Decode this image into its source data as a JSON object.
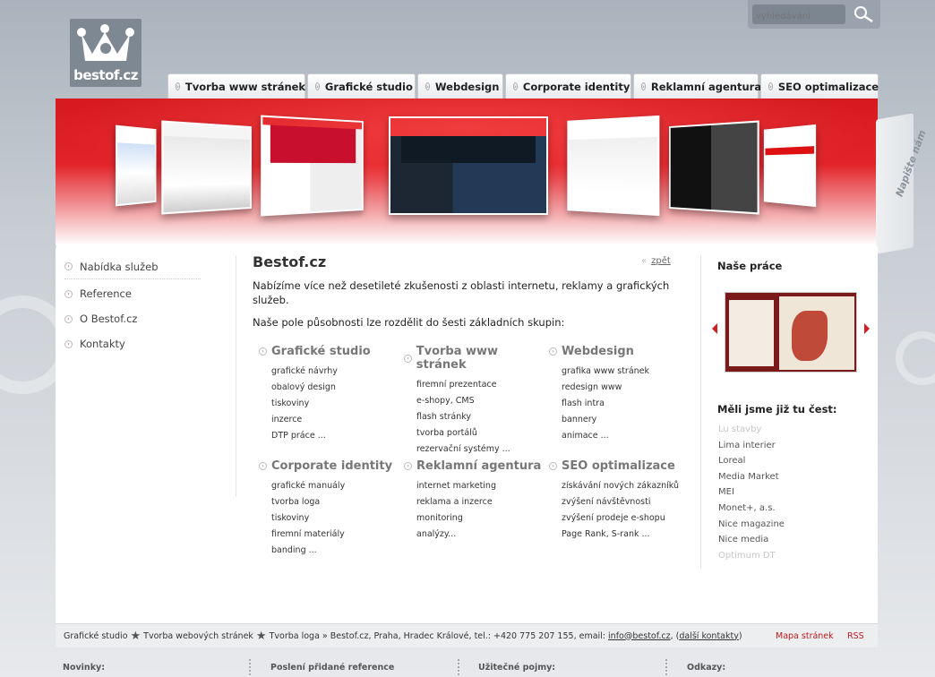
{
  "logo": {
    "text": "bestof.cz"
  },
  "search": {
    "placeholder": "vyhledávání"
  },
  "tabs": [
    "Tvorba www stránek",
    "Grafické studio",
    "Webdesign",
    "Corporate identity",
    "Reklamní agentura",
    "SEO optimalizace"
  ],
  "napiste": "Napište nám",
  "nav": [
    "Nabídka služeb",
    "Reference",
    "O Bestof.cz",
    "Kontakty"
  ],
  "content": {
    "title": "Bestof.cz",
    "back": "zpět",
    "intro": "Nabízíme více než desetileté zkušenosti z oblasti internetu, reklamy a grafických služeb.",
    "intro2": "Naše pole působnosti lze rozdělit do šesti základních skupin:",
    "groups": [
      {
        "title": "Grafické studio",
        "items": [
          "grafické návrhy",
          "obalový design",
          "tiskoviny",
          "inzerce",
          "DTP práce ..."
        ]
      },
      {
        "title": "Tvorba www stránek",
        "items": [
          "firemní prezentace",
          "e-shopy, CMS",
          "flash stránky",
          "tvorba portálů",
          "rezervační systémy ..."
        ]
      },
      {
        "title": "Webdesign",
        "items": [
          "grafika www stránek",
          "redesign www",
          "flash intra",
          "bannery",
          "animace ..."
        ]
      },
      {
        "title": "Corporate identity",
        "items": [
          "grafické manuály",
          "tvorba loga",
          "tiskoviny",
          "firemní materiály",
          "banding ..."
        ]
      },
      {
        "title": "Reklamní agentura",
        "items": [
          "internet marketing",
          "reklama a inzerce",
          "monitoring",
          "analýzy..."
        ]
      },
      {
        "title": "SEO optimalizace",
        "items": [
          "získávání nových zákazníků",
          "zvýšení návštěvnosti",
          "zvýšení prodeje e-shopu",
          "Page Rank, S-rank ..."
        ]
      }
    ]
  },
  "right": {
    "work_title": "Naše práce",
    "honor_title": "Měli jsme již tu čest:",
    "clients": [
      "Lu stavby",
      "Lima interier",
      "Loreal",
      "Media Market",
      "MEI",
      "Monet+, a.s.",
      "Nice magazine",
      "Nice media",
      "Optimum DT"
    ]
  },
  "footer": {
    "link1": "Grafické studio",
    "link2": "Tvorba webových stránek",
    "link3": "Tvorba loga",
    "info": "Bestof.cz, Praha, Hradec Králové, tel.: +420 775 207 155, email:",
    "email": "info@bestof.cz",
    "more_contacts": "další kontakty",
    "sitemap": "Mapa stránek",
    "rss": "RSS"
  },
  "bottom": [
    "Novinky:",
    "Poslení přidané reference",
    "Užitečné pojmy:",
    "Odkazy:"
  ],
  "colors": {
    "brand_red": "#d51a1f",
    "gray_bg": "#aab3bd"
  }
}
